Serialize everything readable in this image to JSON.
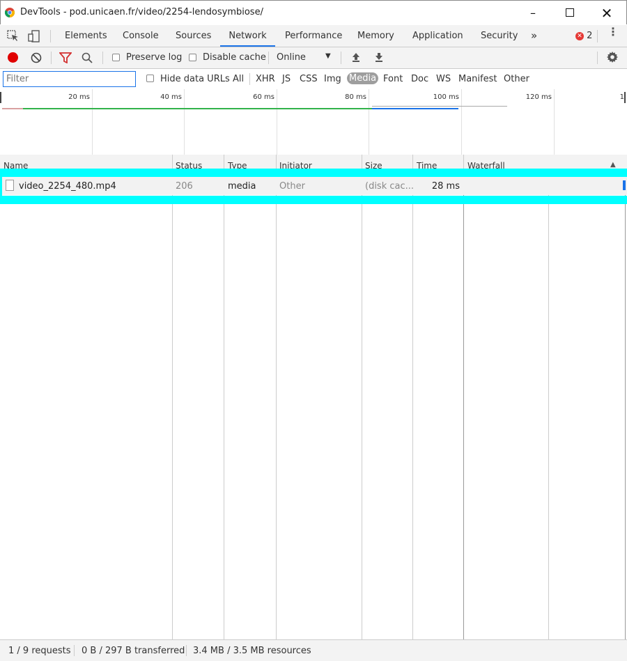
{
  "window": {
    "title": "DevTools - pod.unicaen.fr/video/2254-lendosymbiose/"
  },
  "tabs": [
    {
      "label": "Elements"
    },
    {
      "label": "Console"
    },
    {
      "label": "Sources"
    },
    {
      "label": "Network"
    },
    {
      "label": "Performance"
    },
    {
      "label": "Memory"
    },
    {
      "label": "Application"
    },
    {
      "label": "Security"
    }
  ],
  "errors": {
    "count": "2"
  },
  "toolbar": {
    "preserve_log": "Preserve log",
    "disable_cache": "Disable cache",
    "throttle": "Online"
  },
  "filter": {
    "placeholder": "Filter",
    "hide_data_urls": "Hide data URLs",
    "types": [
      "All",
      "XHR",
      "JS",
      "CSS",
      "Img",
      "Media",
      "Font",
      "Doc",
      "WS",
      "Manifest",
      "Other"
    ],
    "active_type": "Media"
  },
  "overview": {
    "ticks": [
      "20 ms",
      "40 ms",
      "60 ms",
      "80 ms",
      "100 ms",
      "120 ms",
      "1"
    ]
  },
  "columns": [
    "Name",
    "Status",
    "Type",
    "Initiator",
    "Size",
    "Time",
    "Waterfall"
  ],
  "requests": [
    {
      "name": "video_2254_480.mp4",
      "status": "206",
      "type": "media",
      "initiator": "Other",
      "size": "(disk cac...",
      "time": "28 ms"
    }
  ],
  "statusbar": {
    "requests": "1 / 9 requests",
    "transferred": "0 B / 297 B transferred",
    "resources": "3.4 MB / 3.5 MB resources"
  },
  "colors": {
    "accent": "#1a73e8",
    "highlight": "#00ffff",
    "record": "#e00000",
    "filter_icon": "#d32f2f"
  }
}
